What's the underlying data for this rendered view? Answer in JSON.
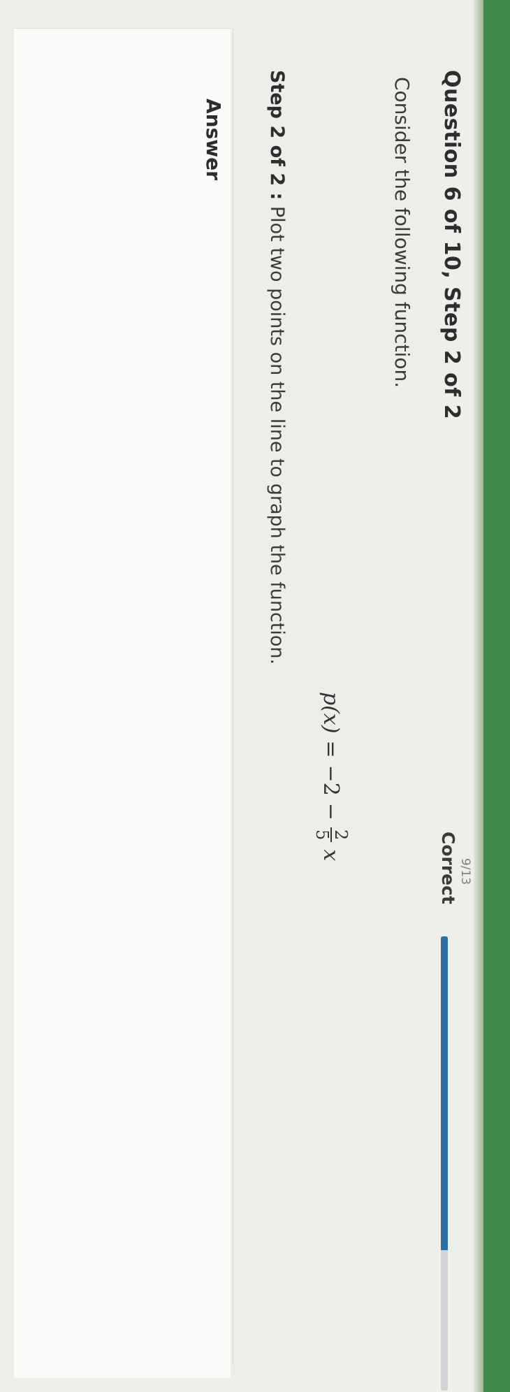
{
  "header": {
    "question_title": "Question 6 of 10, Step 2 of 2",
    "score": {
      "count": "9/13",
      "status": "Correct"
    },
    "progress": 0.69
  },
  "problem": {
    "prompt": "Consider the following function.",
    "formula": {
      "lhs": "p(x)",
      "equals": "=",
      "constant": "−2",
      "minus": "−",
      "numerator": "2",
      "denominator": "5",
      "variable": "x"
    },
    "step": {
      "label": "Step 2 of 2 :",
      "instruction": "Plot two points on the line to graph the function."
    }
  },
  "answer": {
    "label": "Answer"
  },
  "colors": {
    "accent_green": "#3f8a4a",
    "progress_blue": "#2f6fa8"
  }
}
